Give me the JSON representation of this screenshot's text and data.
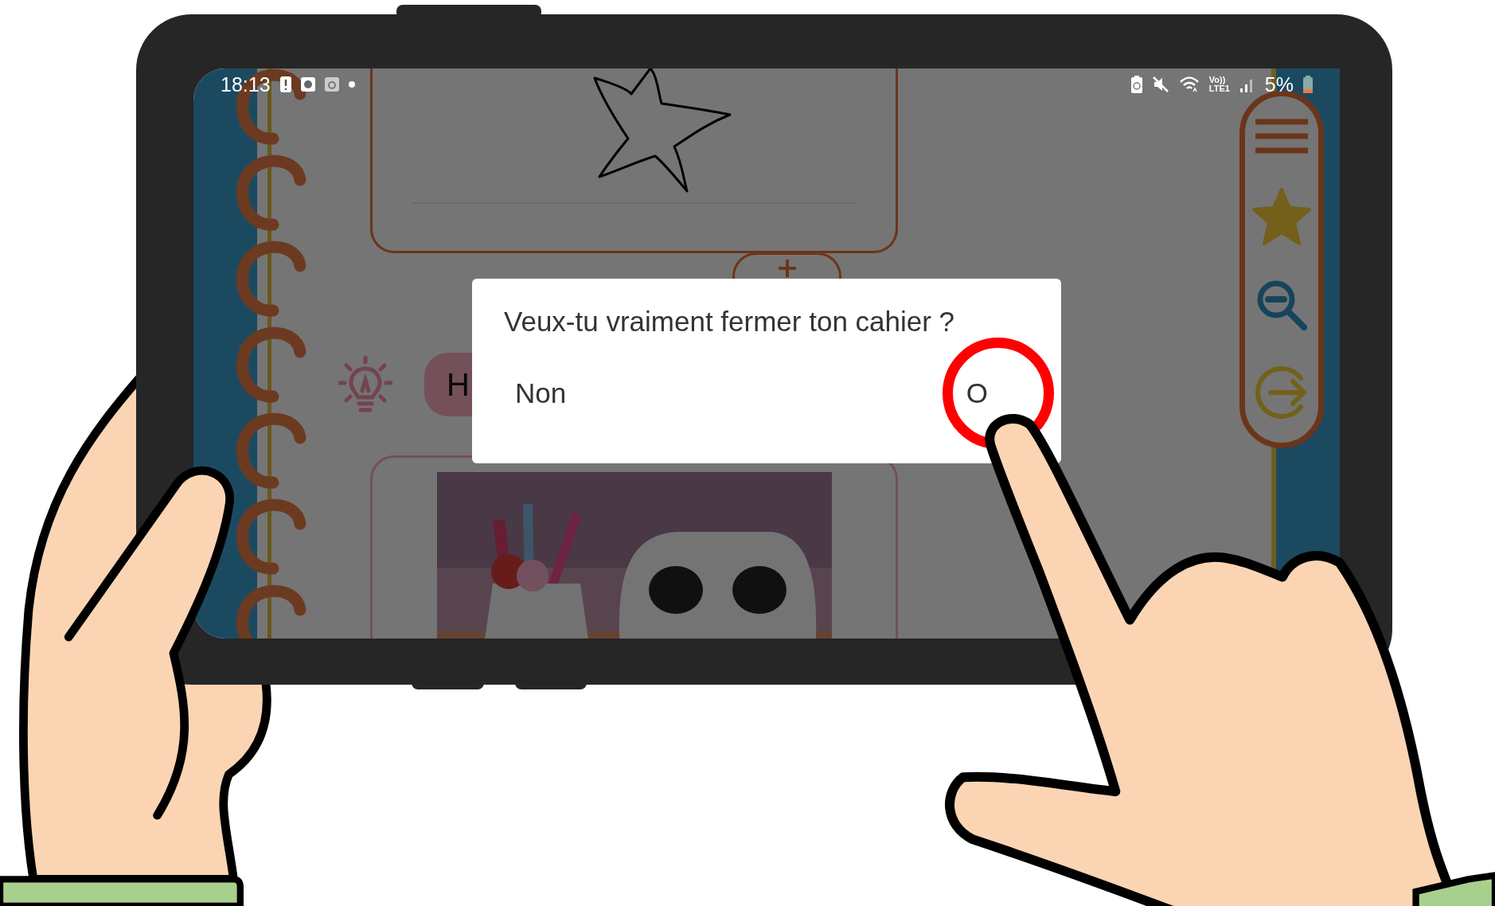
{
  "status_bar": {
    "time": "18:13",
    "volte": "Vo))",
    "network": "LTE1",
    "battery": "5%"
  },
  "notebook": {
    "chip": "H"
  },
  "dialog": {
    "message": "Veux-tu vraiment fermer ton cahier ?",
    "buttons": [
      {
        "label": "Non",
        "circled": false
      },
      {
        "label": "O",
        "circled": true
      }
    ]
  }
}
